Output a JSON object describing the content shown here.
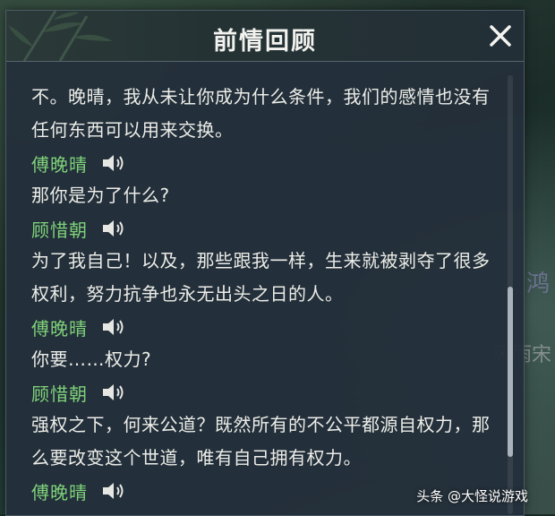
{
  "dialog": {
    "title": "前情回顾",
    "close_icon": "close-icon"
  },
  "scene": {
    "name_1": "鸿",
    "name_2": "风雨宋"
  },
  "entries": [
    {
      "type": "line",
      "text": "不。晚晴，我从未让你成为什么条件，我们的感情也没有任何东西可以用来交换。"
    },
    {
      "type": "speaker",
      "name": "傅晚晴",
      "icon": "speaker-icon"
    },
    {
      "type": "line",
      "text": "那你是为了什么?"
    },
    {
      "type": "speaker",
      "name": "顾惜朝",
      "icon": "speaker-icon"
    },
    {
      "type": "line",
      "text": "为了我自己！以及，那些跟我一样，生来就被剥夺了很多权利，努力抗争也永无出头之日的人。"
    },
    {
      "type": "speaker",
      "name": "傅晚晴",
      "icon": "speaker-icon"
    },
    {
      "type": "line",
      "text": "你要……权力?"
    },
    {
      "type": "speaker",
      "name": "顾惜朝",
      "icon": "speaker-icon"
    },
    {
      "type": "line",
      "text": "强权之下，何来公道？既然所有的不公平都源自权力，那么要改变这个世道，唯有自己拥有权力。"
    },
    {
      "type": "speaker",
      "name": "傅晚晴",
      "icon": "speaker-icon"
    }
  ],
  "colors": {
    "speaker_name": "#7fd27a",
    "dialog_text": "#ecede8"
  },
  "watermark": "头条 @大怪说游戏"
}
